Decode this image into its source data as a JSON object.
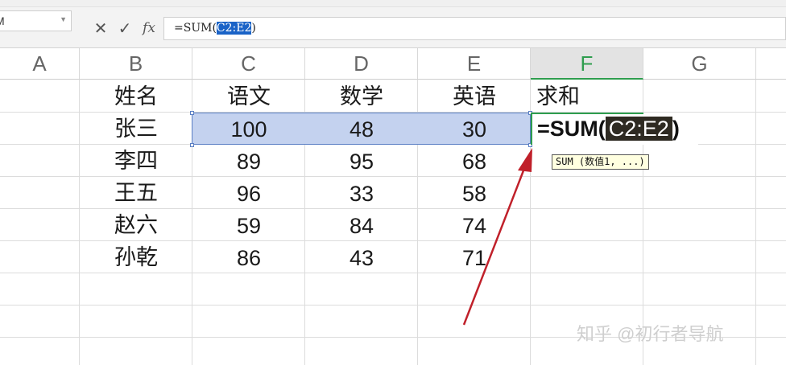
{
  "name_box": {
    "value": "M"
  },
  "formula_bar": {
    "cancel_icon": "close-icon",
    "confirm_icon": "check-icon",
    "fx_label": "fx",
    "formula_prefix": "=SUM(",
    "formula_ref": "C2:E2",
    "formula_suffix": ")"
  },
  "columns": [
    "A",
    "B",
    "C",
    "D",
    "E",
    "F",
    "G"
  ],
  "active_column": "F",
  "header_row": [
    "姓名",
    "语文",
    "数学",
    "英语",
    "求和"
  ],
  "rows": [
    {
      "name": "张三",
      "chinese": "100",
      "math": "48",
      "english": "30"
    },
    {
      "name": "李四",
      "chinese": "89",
      "math": "95",
      "english": "68"
    },
    {
      "name": "王五",
      "chinese": "96",
      "math": "33",
      "english": "58"
    },
    {
      "name": "赵六",
      "chinese": "59",
      "math": "84",
      "english": "74"
    },
    {
      "name": "孙乾",
      "chinese": "86",
      "math": "43",
      "english": "71"
    }
  ],
  "edit_cell": {
    "prefix": "=SUM(",
    "ref": "C2:E2",
    "suffix": ")"
  },
  "tooltip": {
    "text": "SUM (数值1, ...)"
  },
  "watermark": "知乎 @初行者导航",
  "colors": {
    "accent": "#2e9d4e",
    "selection": "#c4d2ef",
    "arrow": "#c0202a"
  }
}
